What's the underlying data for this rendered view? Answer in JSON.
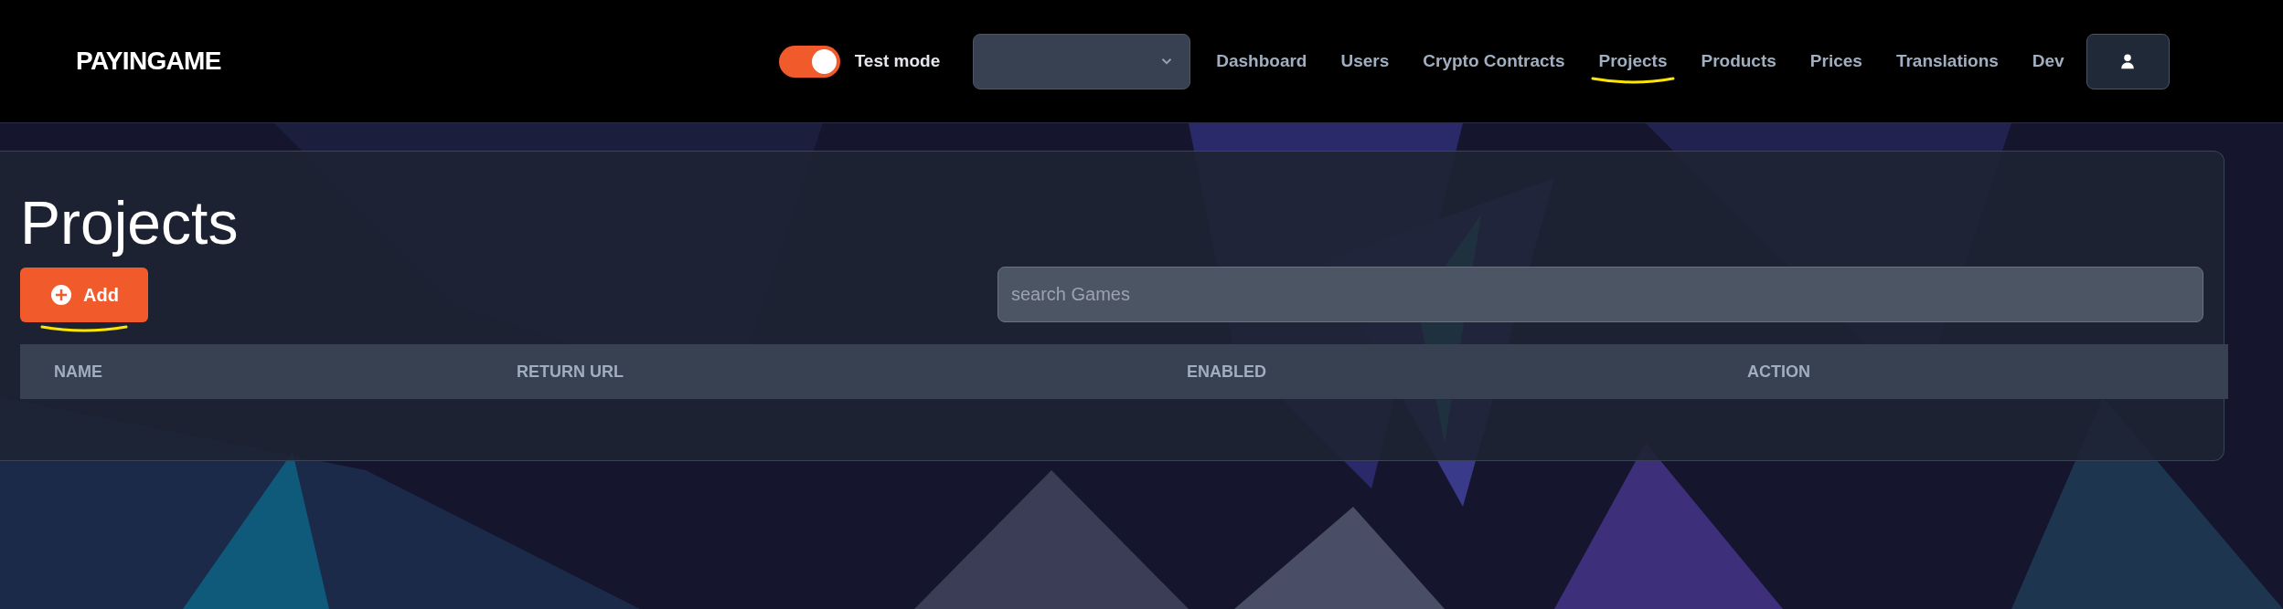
{
  "header": {
    "logo": "PAYINGAME",
    "test_mode": {
      "label": "Test mode",
      "on": true
    },
    "nav": [
      {
        "label": "Dashboard",
        "selected": false,
        "annotated": false
      },
      {
        "label": "Users",
        "selected": false,
        "annotated": false
      },
      {
        "label": "Crypto Contracts",
        "selected": false,
        "annotated": false
      },
      {
        "label": "Projects",
        "selected": false,
        "annotated": true
      },
      {
        "label": "Products",
        "selected": false,
        "annotated": false
      },
      {
        "label": "Prices",
        "selected": false,
        "annotated": false
      },
      {
        "label": "Translations",
        "selected": false,
        "annotated": false
      },
      {
        "label": "Dev",
        "selected": false,
        "annotated": false
      }
    ]
  },
  "page": {
    "title": "Projects",
    "add_button": {
      "label": "Add",
      "annotated": true
    },
    "search": {
      "placeholder": "search Games"
    },
    "table": {
      "columns": [
        "NAME",
        "RETURN URL",
        "ENABLED",
        "ACTION"
      ]
    }
  }
}
